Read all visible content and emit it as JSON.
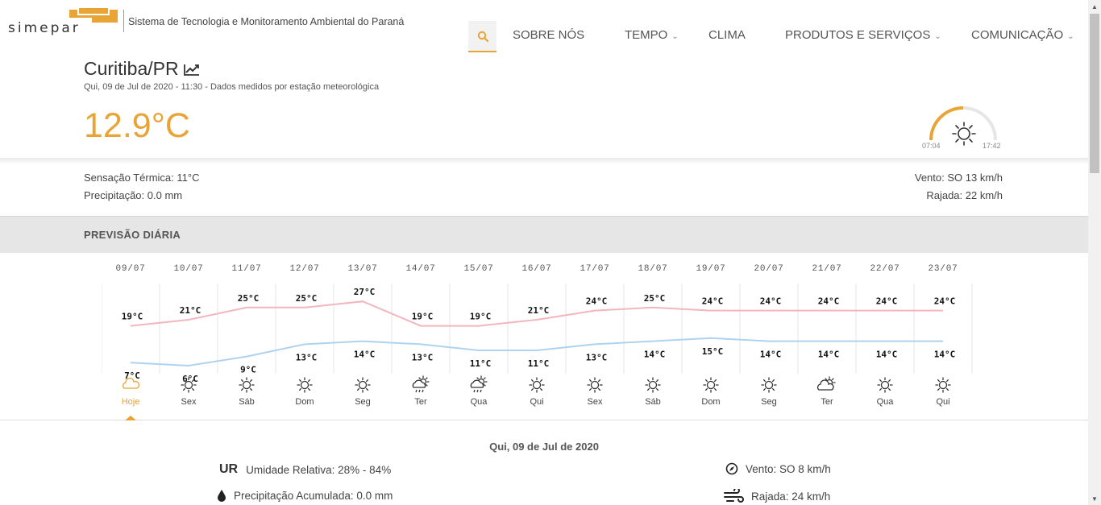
{
  "header": {
    "logo_alt": "simepar",
    "tagline": "Sistema de Tecnologia e Monitoramento Ambiental do Paraná",
    "nav": [
      {
        "label": "SOBRE NÓS",
        "has_dropdown": false
      },
      {
        "label": "TEMPO",
        "has_dropdown": true
      },
      {
        "label": "CLIMA",
        "has_dropdown": false
      },
      {
        "label": "PRODUTOS E SERVIÇOS",
        "has_dropdown": true
      },
      {
        "label": "COMUNICAÇÃO",
        "has_dropdown": true
      }
    ]
  },
  "current": {
    "city": "Curitiba/PR",
    "updated": "Qui, 09 de Jul de 2020 - 11:30 - Dados medidos por estação meteorológica",
    "temperature": "12.9°C",
    "sunrise": "07:04",
    "sunset": "17:42",
    "sensacao": "Sensação Térmica: 11°C",
    "precipitacao": "Precipitação: 0.0 mm",
    "vento": "Vento: SO 13 km/h",
    "rajada": "Rajada: 22 km/h"
  },
  "forecast": {
    "section_title": "PREVISÃO DIÁRIA",
    "days": [
      {
        "date": "09/07",
        "day": "Hoje",
        "max": 19,
        "min": 7,
        "icon": "cloud-icon"
      },
      {
        "date": "10/07",
        "day": "Sex",
        "max": 21,
        "min": 6,
        "icon": "sun-icon"
      },
      {
        "date": "11/07",
        "day": "Sáb",
        "max": 25,
        "min": 9,
        "icon": "sun-icon"
      },
      {
        "date": "12/07",
        "day": "Dom",
        "max": 25,
        "min": 13,
        "icon": "sun-icon"
      },
      {
        "date": "13/07",
        "day": "Seg",
        "max": 27,
        "min": 14,
        "icon": "sun-icon"
      },
      {
        "date": "14/07",
        "day": "Ter",
        "max": 19,
        "min": 13,
        "icon": "sun-cloud-rain-icon"
      },
      {
        "date": "15/07",
        "day": "Qua",
        "max": 19,
        "min": 11,
        "icon": "sun-cloud-rain-icon"
      },
      {
        "date": "16/07",
        "day": "Qui",
        "max": 21,
        "min": 11,
        "icon": "sun-icon"
      },
      {
        "date": "17/07",
        "day": "Sex",
        "max": 24,
        "min": 13,
        "icon": "sun-icon"
      },
      {
        "date": "18/07",
        "day": "Sáb",
        "max": 25,
        "min": 14,
        "icon": "sun-icon"
      },
      {
        "date": "19/07",
        "day": "Dom",
        "max": 24,
        "min": 15,
        "icon": "sun-icon"
      },
      {
        "date": "20/07",
        "day": "Seg",
        "max": 24,
        "min": 14,
        "icon": "sun-icon"
      },
      {
        "date": "21/07",
        "day": "Ter",
        "max": 24,
        "min": 14,
        "icon": "sun-cloud-icon"
      },
      {
        "date": "22/07",
        "day": "Qua",
        "max": 24,
        "min": 14,
        "icon": "sun-icon"
      },
      {
        "date": "23/07",
        "day": "Qui",
        "max": 24,
        "min": 14,
        "icon": "sun-icon"
      }
    ],
    "unit": "°C",
    "colors": {
      "max": "#f4b6bd",
      "min": "#aed3ef",
      "accent": "#e8a435"
    }
  },
  "detail": {
    "date": "Qui, 09 de Jul de 2020",
    "ur_tag": "UR",
    "umidade": "Umidade Relativa: 28% - 84%",
    "precip": "Precipitação Acumulada: 0.0 mm",
    "vento": "Vento: SO 8 km/h",
    "rajada": "Rajada: 24 km/h"
  }
}
